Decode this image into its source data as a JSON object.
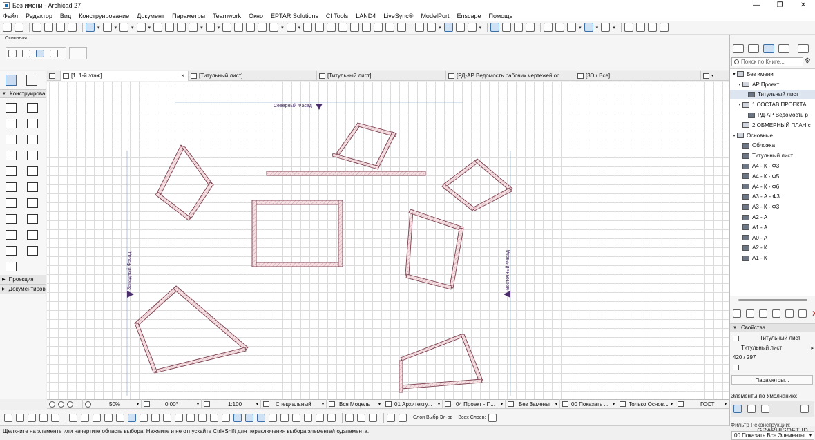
{
  "window": {
    "title": "Без имени - Archicad 27",
    "minimize": "—",
    "maximize": "❐",
    "close": "✕"
  },
  "menu": [
    "Файл",
    "Редактор",
    "Вид",
    "Конструирование",
    "Документ",
    "Параметры",
    "Teamwork",
    "Окно",
    "EPTAR Solutions",
    "CI Tools",
    "LAND4",
    "LiveSync®",
    "ModelPort",
    "Enscape",
    "Помощь"
  ],
  "infobox": {
    "label": "Основная:"
  },
  "toolbox": {
    "design_section": "Конструирование",
    "projection_section": "Проекция",
    "documenting_section": "Документирование"
  },
  "tabs": [
    {
      "label": "[1. 1-й этаж]",
      "close": "×"
    },
    {
      "label": "[Титульный лист]"
    },
    {
      "label": "[Титульный лист]"
    },
    {
      "label": "[РД-АР Ведомость рабочих чертежей ос..."
    },
    {
      "label": "[3D / Все]"
    }
  ],
  "markers": {
    "north": "Северный Фасад",
    "west": "Западный Фасад",
    "east": "Восточный Фасад"
  },
  "navbar": {
    "zoom": "50%",
    "angle": "0,00°",
    "scale": "1:100",
    "structure": "Специальный",
    "model": "Вся Модель",
    "layer": "01 Архитекту...",
    "pen": "04 Проект - П...",
    "overrides": "Без Замены",
    "renovation": "00 Показать ...",
    "view": "Только Основ...",
    "dimension": "ГОСТ"
  },
  "bottombar": {
    "layers_label": "Слои Выбр.Эл-ов",
    "all_layers_label": "Всех Слоев:"
  },
  "status": {
    "hint": "Щелкните на элементе или начертите область выбора. Нажмите и не отпускайте Ctrl+Shift для переключения выбора элемента/подэлемента.",
    "brand": "GRAPHISOFT ID"
  },
  "navigator": {
    "search_placeholder": "Поиск по Книге...",
    "tree": [
      {
        "label": "Без имени",
        "level": 0,
        "exp": "▾",
        "icon": "folder"
      },
      {
        "label": "АР Проект",
        "level": 1,
        "exp": "▾",
        "icon": "folder"
      },
      {
        "label": "Титульный лист",
        "level": 2,
        "exp": "",
        "icon": "sheet",
        "selected": true
      },
      {
        "label": "1 СОСТАВ ПРОЕКТА",
        "level": 1,
        "exp": "▾",
        "icon": "folder"
      },
      {
        "label": "РД-АР Ведомость р",
        "level": 2,
        "exp": "",
        "icon": "sheet"
      },
      {
        "label": "2 ОБМЕРНЫЙ ПЛАН с",
        "level": 1,
        "exp": "",
        "icon": "folder"
      },
      {
        "label": "Основные",
        "level": 0,
        "exp": "▾",
        "icon": "folder"
      },
      {
        "label": "Обложка",
        "level": 1,
        "exp": "",
        "icon": "sheet"
      },
      {
        "label": "Титульный лист",
        "level": 1,
        "exp": "",
        "icon": "sheet"
      },
      {
        "label": "А4 - К - Ф3",
        "level": 1,
        "exp": "",
        "icon": "sheet"
      },
      {
        "label": "А4 - К - Ф5",
        "level": 1,
        "exp": "",
        "icon": "sheet"
      },
      {
        "label": "А4 - К - Ф6",
        "level": 1,
        "exp": "",
        "icon": "sheet"
      },
      {
        "label": "А3 - А - Ф3",
        "level": 1,
        "exp": "",
        "icon": "sheet"
      },
      {
        "label": "А3 - К - Ф3",
        "level": 1,
        "exp": "",
        "icon": "sheet"
      },
      {
        "label": "А2 - А",
        "level": 1,
        "exp": "",
        "icon": "sheet"
      },
      {
        "label": "А1 - А",
        "level": 1,
        "exp": "",
        "icon": "sheet"
      },
      {
        "label": "А0 - А",
        "level": 1,
        "exp": "",
        "icon": "sheet"
      },
      {
        "label": "А2 - К",
        "level": 1,
        "exp": "",
        "icon": "sheet"
      },
      {
        "label": "А1 - К",
        "level": 1,
        "exp": "",
        "icon": "sheet"
      }
    ],
    "properties_head": "Свойства",
    "prop_name": "Титульный лист",
    "prop_master": "Титульный лист",
    "prop_size": "420 / 297",
    "params_button": "Параметры...",
    "defaults_label": "Элементы по Умолчанию:",
    "renovation_label": "Фильтр Реконструкции:",
    "renovation_value": "00 Показать Все Элементы"
  },
  "colors": {
    "accent": "#3a6fa8",
    "wall_fill": "#f2d9dc",
    "wall_stroke": "#7a4050",
    "marker": "#4a2d6b"
  }
}
